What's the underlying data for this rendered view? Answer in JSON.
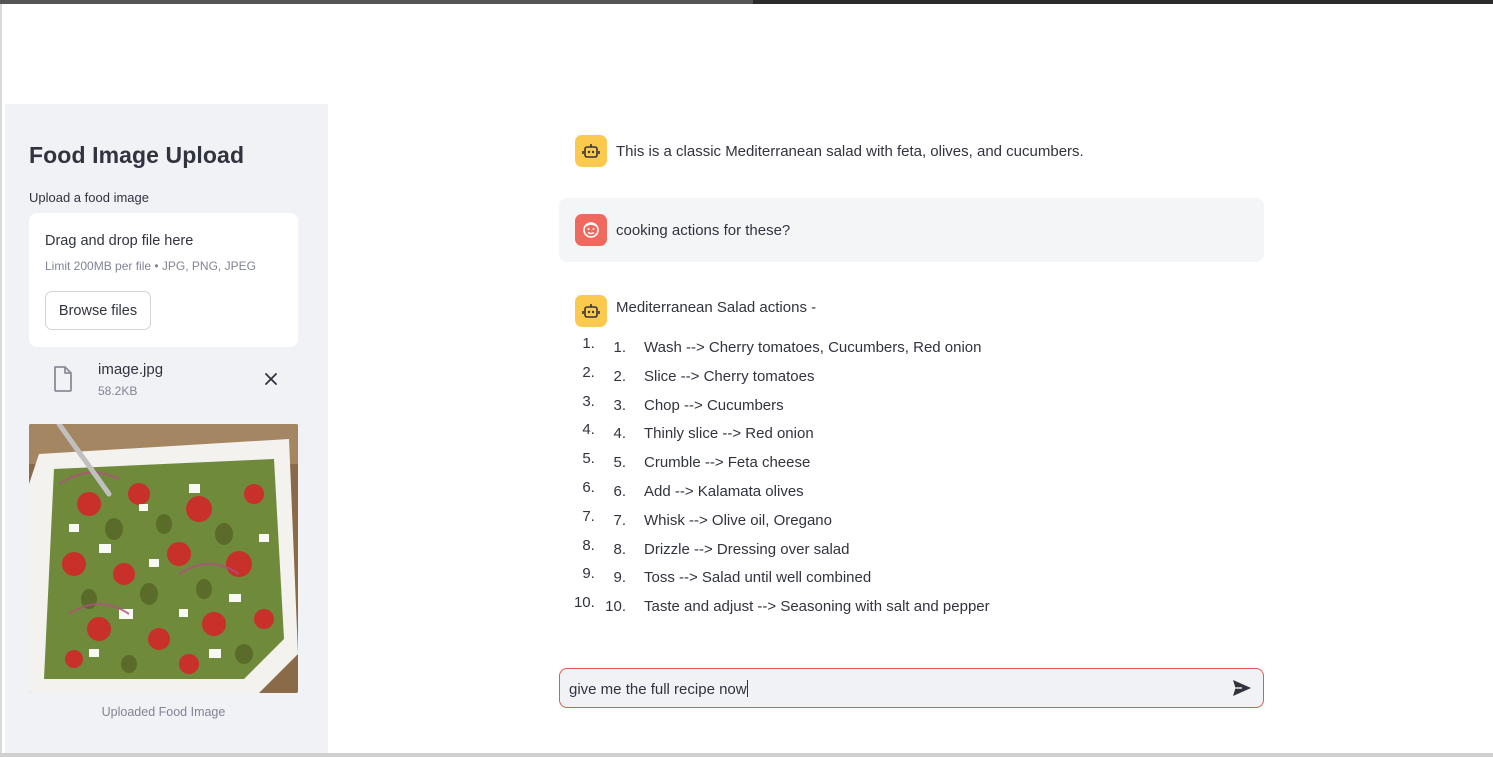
{
  "sidebar": {
    "title": "Food Image Upload",
    "upload_label": "Upload a food image",
    "dropzone": {
      "title": "Drag and drop file here",
      "limit": "Limit 200MB per file • JPG, PNG, JPEG",
      "browse_label": "Browse files"
    },
    "file": {
      "name": "image.jpg",
      "size": "58.2KB",
      "icon": "file-icon",
      "remove_icon": "close-icon"
    },
    "image_caption": "Uploaded Food Image"
  },
  "chat": {
    "messages": [
      {
        "role": "assistant",
        "avatar": "robot-icon",
        "text": "This is a classic Mediterranean salad with feta, olives, and cucumbers."
      },
      {
        "role": "user",
        "avatar": "user-face-icon",
        "text": "cooking actions for these?"
      },
      {
        "role": "assistant",
        "avatar": "robot-icon",
        "text": "Mediterranean Salad actions -"
      }
    ],
    "steps": [
      {
        "num": "1.",
        "text": "Wash --> Cherry tomatoes, Cucumbers, Red onion"
      },
      {
        "num": "2.",
        "text": "Slice --> Cherry tomatoes"
      },
      {
        "num": "3.",
        "text": "Chop --> Cucumbers"
      },
      {
        "num": "4.",
        "text": "Thinly slice --> Red onion"
      },
      {
        "num": "5.",
        "text": "Crumble --> Feta cheese"
      },
      {
        "num": "6.",
        "text": "Add --> Kalamata olives"
      },
      {
        "num": "7.",
        "text": "Whisk --> Olive oil, Oregano"
      },
      {
        "num": "8.",
        "text": "Drizzle --> Dressing over salad"
      },
      {
        "num": "9.",
        "text": "Toss --> Salad until well combined"
      },
      {
        "num": "10.",
        "text": "Taste and adjust --> Seasoning with salt and pepper"
      }
    ],
    "input": {
      "value": "give me the full recipe now",
      "send_icon": "send-icon"
    }
  },
  "colors": {
    "sidebar_bg": "#f0f2f6",
    "bot_avatar": "#fbc94d",
    "user_avatar": "#f0695f",
    "input_border": "#e0584e",
    "text": "#31333f",
    "muted": "#808495"
  }
}
